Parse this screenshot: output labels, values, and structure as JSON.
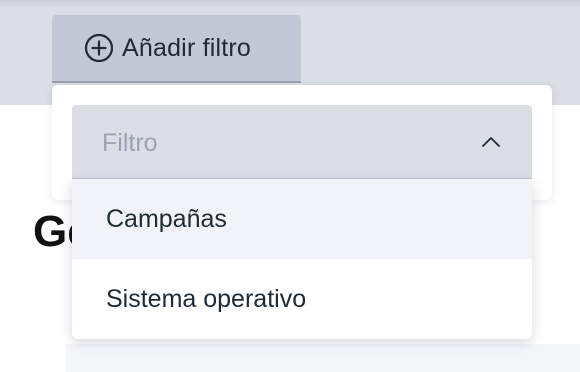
{
  "add_filter_button": {
    "icon": "plus-circle-icon",
    "label": "Añadir filtro"
  },
  "heading_partial": "Ge",
  "filter_select": {
    "placeholder": "Filtro",
    "icon": "chevron-up-icon",
    "expanded": true,
    "options": [
      {
        "label": "Campañas",
        "highlighted": true
      },
      {
        "label": "Sistema operativo",
        "highlighted": false
      }
    ]
  },
  "colors": {
    "button_bg": "#c4c7d6",
    "band_bg": "#dcdee6",
    "text": "#1e2a36",
    "placeholder": "#9ea2b2",
    "option_highlight": "#f2f3f8"
  }
}
